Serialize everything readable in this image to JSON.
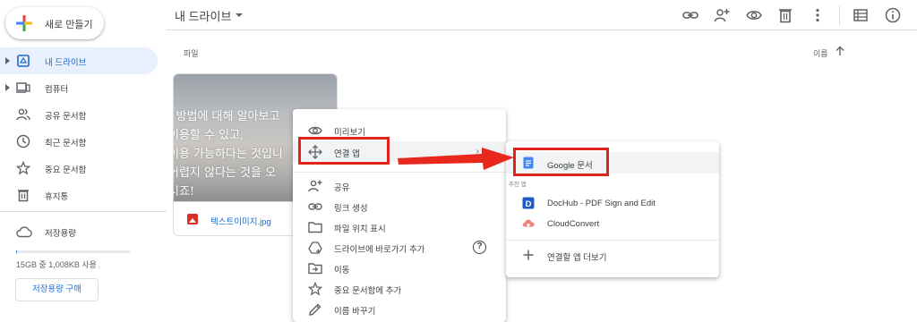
{
  "sidebar": {
    "new_button": "새로 만들기",
    "items": [
      {
        "label": "내 드라이브",
        "icon": "drive-icon"
      },
      {
        "label": "컴퓨터",
        "icon": "computer-icon"
      },
      {
        "label": "공유 문서함",
        "icon": "people-icon"
      },
      {
        "label": "최근 문서함",
        "icon": "clock-icon"
      },
      {
        "label": "중요 문서함",
        "icon": "star-icon"
      },
      {
        "label": "휴지통",
        "icon": "trash-icon"
      }
    ],
    "storage_label": "저장용량",
    "storage_usage": "15GB 중 1,008KB 사용",
    "storage_fill_fraction": 0.0001,
    "buy_storage": "저장용량 구매"
  },
  "header": {
    "title": "내 드라이브",
    "icons": [
      "link-icon",
      "add-person-icon",
      "eye-icon",
      "trash-icon",
      "more-vert-icon",
      "list-view-icon",
      "info-icon"
    ]
  },
  "content": {
    "files_label": "파일",
    "sort_label": "이름",
    "file": {
      "name": "텍스트이미지.jpg",
      "thumb_lines": [
        "- 방법에 대해 알아보고",
        "이용할 수 있고,",
        "이용 가능하다는 것입니",
        "어렵지 않다는 것을 오",
        "시죠!"
      ]
    }
  },
  "context_menu": {
    "items": [
      {
        "label": "미리보기",
        "icon": "eye-icon"
      },
      {
        "label": "연결 앱",
        "icon": "move-icon",
        "arrow": "›"
      },
      {
        "label": "공유",
        "icon": "add-person-icon"
      },
      {
        "label": "링크 생성",
        "icon": "link-icon"
      },
      {
        "label": "파일 위치 표시",
        "icon": "folder-icon"
      },
      {
        "label": "드라이브에 바로가기 추가",
        "icon": "drive-shortcut-icon",
        "help": "?"
      },
      {
        "label": "이동",
        "icon": "move-to-icon"
      },
      {
        "label": "중요 문서함에 추가",
        "icon": "star-icon"
      },
      {
        "label": "이름 바꾸기",
        "icon": "pencil-icon"
      }
    ]
  },
  "submenu": {
    "google_docs": "Google 문서",
    "section_label": "추천 앱",
    "apps": [
      "DocHub - PDF Sign and Edit",
      "CloudConvert"
    ],
    "more_apps": "연결할 앱 더보기"
  },
  "colors": {
    "accent": "#1a73e8",
    "highlight_red": "#e0241b",
    "active_nav_bg": "#e8f0fe"
  }
}
